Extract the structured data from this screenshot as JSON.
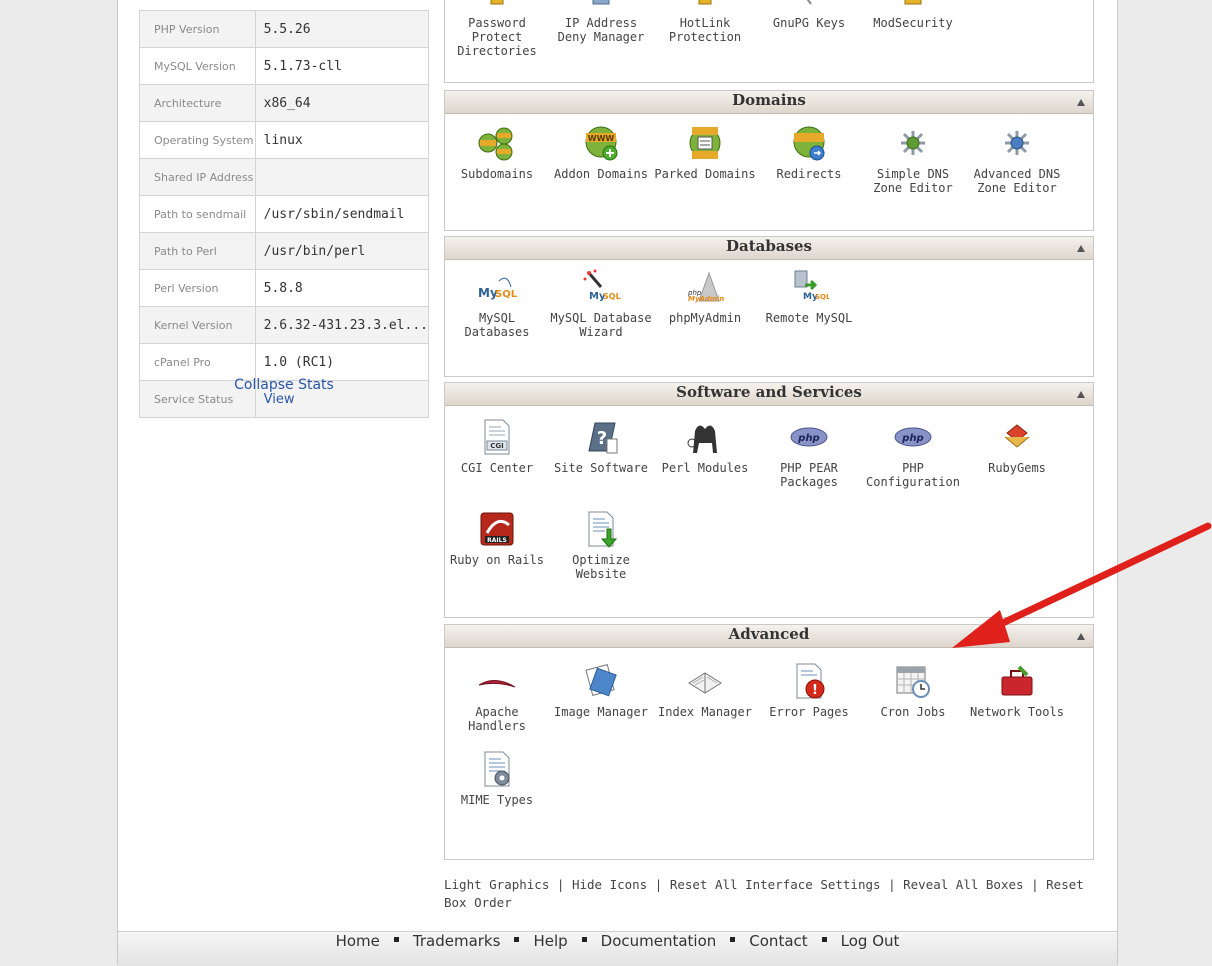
{
  "stats": [
    {
      "label": "PHP Version",
      "value": "5.5.26"
    },
    {
      "label": "MySQL Version",
      "value": "5.1.73-cll"
    },
    {
      "label": "Architecture",
      "value": "x86_64"
    },
    {
      "label": "Operating System",
      "value": "linux"
    },
    {
      "label": "Shared IP Address",
      "value": ""
    },
    {
      "label": "Path to sendmail",
      "value": "/usr/sbin/sendmail"
    },
    {
      "label": "Path to Perl",
      "value": "/usr/bin/perl"
    },
    {
      "label": "Perl Version",
      "value": "5.8.8"
    },
    {
      "label": "Kernel Version",
      "value": "2.6.32-431.23.3.el..."
    },
    {
      "label": "cPanel Pro",
      "value": "1.0 (RC1)"
    },
    {
      "label": "Service Status",
      "value": "View"
    }
  ],
  "collapse_stats": "Collapse Stats",
  "security": {
    "items": [
      {
        "label": "Password Protect Directories",
        "icon": "password-protect-icon"
      },
      {
        "label": "IP Address Deny Manager",
        "icon": "ip-deny-icon"
      },
      {
        "label": "HotLink Protection",
        "icon": "hotlink-icon"
      },
      {
        "label": "GnuPG Keys",
        "icon": "gnupg-icon"
      },
      {
        "label": "ModSecurity",
        "icon": "modsecurity-icon"
      }
    ]
  },
  "domains": {
    "title": "Domains",
    "items": [
      {
        "label": "Subdomains",
        "icon": "subdomains-icon"
      },
      {
        "label": "Addon Domains",
        "icon": "addon-domains-icon"
      },
      {
        "label": "Parked Domains",
        "icon": "parked-domains-icon"
      },
      {
        "label": "Redirects",
        "icon": "redirects-icon"
      },
      {
        "label": "Simple DNS Zone Editor",
        "icon": "simple-dns-icon"
      },
      {
        "label": "Advanced DNS Zone Editor",
        "icon": "advanced-dns-icon"
      }
    ]
  },
  "databases": {
    "title": "Databases",
    "items": [
      {
        "label": "MySQL Databases",
        "icon": "mysql-icon"
      },
      {
        "label": "MySQL Database Wizard",
        "icon": "mysql-wizard-icon"
      },
      {
        "label": "phpMyAdmin",
        "icon": "phpmyadmin-icon"
      },
      {
        "label": "Remote MySQL",
        "icon": "remote-mysql-icon"
      }
    ]
  },
  "software": {
    "title": "Software and Services",
    "items": [
      {
        "label": "CGI Center",
        "icon": "cgi-icon"
      },
      {
        "label": "Site Software",
        "icon": "site-software-icon"
      },
      {
        "label": "Perl Modules",
        "icon": "perl-camel-icon"
      },
      {
        "label": "PHP PEAR Packages",
        "icon": "php-pear-icon"
      },
      {
        "label": "PHP Configuration",
        "icon": "php-config-icon"
      },
      {
        "label": "RubyGems",
        "icon": "rubygems-icon"
      },
      {
        "label": "Ruby on Rails",
        "icon": "rails-icon"
      },
      {
        "label": "Optimize Website",
        "icon": "optimize-icon"
      }
    ]
  },
  "advanced": {
    "title": "Advanced",
    "items": [
      {
        "label": "Apache Handlers",
        "icon": "apache-feather-icon"
      },
      {
        "label": "Image Manager",
        "icon": "image-manager-icon"
      },
      {
        "label": "Index Manager",
        "icon": "index-manager-icon"
      },
      {
        "label": "Error Pages",
        "icon": "error-pages-icon"
      },
      {
        "label": "Cron Jobs",
        "icon": "calendar-clock-icon"
      },
      {
        "label": "Network Tools",
        "icon": "toolbox-icon"
      },
      {
        "label": "MIME Types",
        "icon": "mime-types-icon"
      }
    ]
  },
  "bottom_links": {
    "light_graphics": "Light Graphics",
    "hide_icons": "Hide Icons",
    "reset_interface": "Reset All Interface Settings",
    "reveal_boxes": "Reveal All Boxes",
    "reset_box_order": "Reset Box Order",
    "sep": "|"
  },
  "footer_nav": [
    "Home",
    "Trademarks",
    "Help",
    "Documentation",
    "Contact",
    "Log Out"
  ],
  "colors": {
    "link": "#2a57a6",
    "arrow": "#e0201b",
    "header_bg": "#e5dfd8"
  }
}
